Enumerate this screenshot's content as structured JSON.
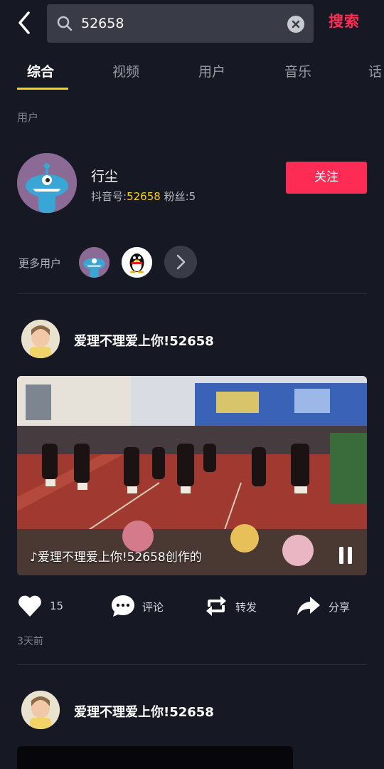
{
  "search": {
    "query": "52658",
    "submit_label": "搜索"
  },
  "tabs": [
    {
      "label": "综合",
      "active": true
    },
    {
      "label": "视频",
      "active": false
    },
    {
      "label": "用户",
      "active": false
    },
    {
      "label": "音乐",
      "active": false
    },
    {
      "label": "话",
      "active": false
    }
  ],
  "users_section": {
    "title": "用户",
    "user": {
      "name": "行尘",
      "id_label": "抖音号:",
      "id_value": "52658",
      "fans_label": "粉丝:",
      "fans_value": "5",
      "follow_label": "关注"
    },
    "more_label": "更多用户"
  },
  "posts": [
    {
      "author": "爱理不理爱上你!52658",
      "video_caption": "♪爱理不理爱上你!52658创作的",
      "likes": "15",
      "comment_label": "评论",
      "repost_label": "转发",
      "share_label": "分享",
      "time": "3天前"
    },
    {
      "author": "爱理不理爱上你!52658"
    }
  ],
  "colors": {
    "background": "#161824",
    "accent_red": "#fe2c55",
    "accent_yellow": "#face15"
  },
  "icons": [
    "back-arrow-icon",
    "search-icon",
    "clear-icon",
    "chevron-right-icon",
    "heart-icon",
    "comment-icon",
    "repost-icon",
    "share-icon",
    "pause-icon",
    "music-note-icon"
  ]
}
